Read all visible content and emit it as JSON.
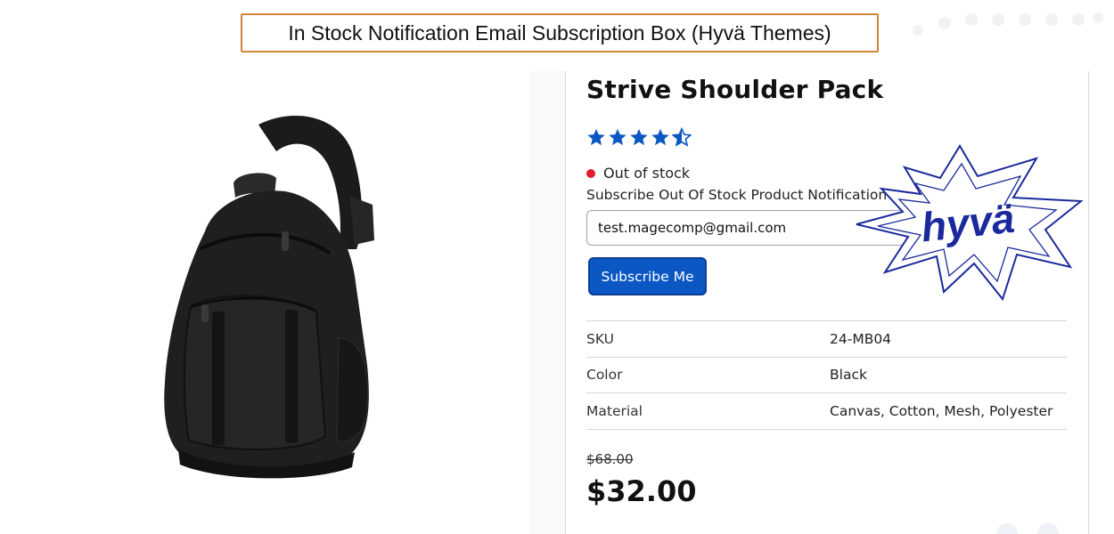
{
  "banner": {
    "title": "In Stock Notification Email Subscription Box (Hyvä Themes)"
  },
  "product": {
    "name": "Strive Shoulder Pack",
    "rating": {
      "value": 4.5,
      "max": 5,
      "color": "#0b57c4"
    },
    "stock_status": "Out of stock",
    "stock_color": "#e11d2e",
    "subscribe_label": "Subscribe Out Of Stock Product Notification",
    "email_value": "test.magecomp@gmail.com",
    "subscribe_button": "Subscribe Me",
    "attributes": [
      {
        "label": "SKU",
        "value": "24-MB04"
      },
      {
        "label": "Color",
        "value": "Black"
      },
      {
        "label": "Material",
        "value": "Canvas, Cotton, Mesh, Polyester"
      }
    ],
    "old_price": "$68.00",
    "price": "$32.00"
  },
  "logo": {
    "text": "hyvä",
    "color": "#1a2a9c"
  },
  "colors": {
    "accent": "#0b57c4",
    "banner_border": "#d0873a"
  }
}
